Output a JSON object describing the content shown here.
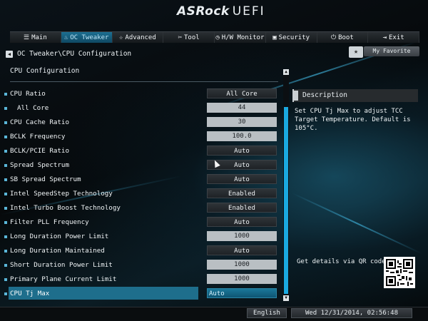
{
  "header": {
    "brand": "ASRock",
    "product": "UEFI"
  },
  "tabs": [
    {
      "label": "Main",
      "icon": "list-icon",
      "active": false
    },
    {
      "label": "OC Tweaker",
      "icon": "flame-icon",
      "active": true
    },
    {
      "label": "Advanced",
      "icon": "star-icon",
      "active": false
    },
    {
      "label": "Tool",
      "icon": "tools-icon",
      "active": false
    },
    {
      "label": "H/W Monitor",
      "icon": "clock-icon",
      "active": false
    },
    {
      "label": "Security",
      "icon": "shield-icon",
      "active": false
    },
    {
      "label": "Boot",
      "icon": "power-icon",
      "active": false
    },
    {
      "label": "Exit",
      "icon": "exit-icon",
      "active": false
    }
  ],
  "breadcrumb": "OC Tweaker\\CPU Configuration",
  "favorite_label": "My Favorite",
  "panel_title": "CPU Configuration",
  "settings": [
    {
      "label": "CPU Ratio",
      "value": "All Core",
      "kind": "btn"
    },
    {
      "label": "All Core",
      "value": "44",
      "kind": "input",
      "indent": true
    },
    {
      "label": "CPU Cache Ratio",
      "value": "30",
      "kind": "input"
    },
    {
      "label": "BCLK Frequency",
      "value": "100.0",
      "kind": "input"
    },
    {
      "label": "BCLK/PCIE Ratio",
      "value": "Auto",
      "kind": "btn"
    },
    {
      "label": "Spread Spectrum",
      "value": "Auto",
      "kind": "btn"
    },
    {
      "label": "SB Spread Spectrum",
      "value": "Auto",
      "kind": "btn"
    },
    {
      "label": "Intel SpeedStep Technology",
      "value": "Enabled",
      "kind": "btn"
    },
    {
      "label": "Intel Turbo Boost Technology",
      "value": "Enabled",
      "kind": "btn"
    },
    {
      "label": "Filter PLL Frequency",
      "value": "Auto",
      "kind": "btn"
    },
    {
      "label": "Long Duration Power Limit",
      "value": "1000",
      "kind": "input"
    },
    {
      "label": "Long Duration Maintained",
      "value": "Auto",
      "kind": "btn"
    },
    {
      "label": "Short Duration Power Limit",
      "value": "1000",
      "kind": "input"
    },
    {
      "label": "Primary Plane Current Limit",
      "value": "1000",
      "kind": "input"
    },
    {
      "label": "CPU Tj Max",
      "value": "Auto",
      "kind": "btn",
      "selected": true
    }
  ],
  "description": {
    "title": "Description",
    "text": "Set CPU Tj Max to adjust TCC Target Temperature. Default is 105°C."
  },
  "qr_label": "Get details via QR code",
  "footer": {
    "language": "English",
    "datetime": "Wed 12/31/2014, 02:56:48"
  },
  "colors": {
    "accent": "#1aa9e0",
    "selected": "#1e6e8c"
  }
}
